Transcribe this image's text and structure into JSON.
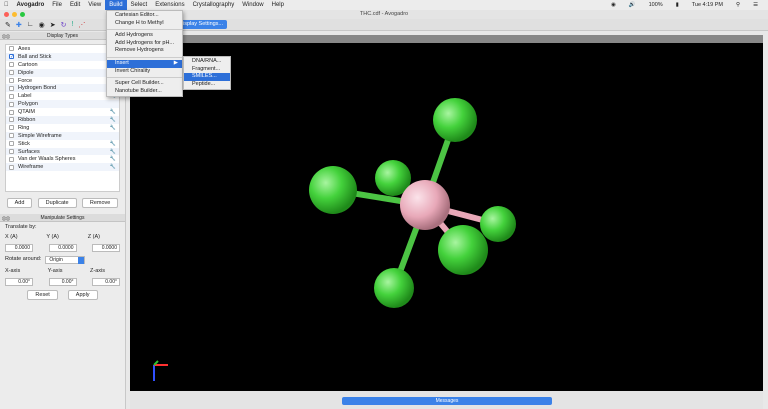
{
  "menubar": {
    "apple": "",
    "items": [
      "Avogadro",
      "File",
      "Edit",
      "View",
      "Build",
      "Select",
      "Extensions",
      "Crystallography",
      "Window",
      "Help"
    ],
    "battery": "100%",
    "clock": "Tue 4:19 PM"
  },
  "window": {
    "title": "THC.cdf - Avogadro"
  },
  "toolbar": {
    "display_settings": "Display Settings..."
  },
  "display_types": {
    "title": "Display Types",
    "items": [
      {
        "label": "Axes",
        "checked": false,
        "config": false
      },
      {
        "label": "Ball and Stick",
        "checked": true,
        "config": true
      },
      {
        "label": "Cartoon",
        "checked": false,
        "config": true
      },
      {
        "label": "Dipole",
        "checked": false,
        "config": false
      },
      {
        "label": "Force",
        "checked": false,
        "config": false
      },
      {
        "label": "Hydrogen Bond",
        "checked": false,
        "config": true
      },
      {
        "label": "Label",
        "checked": false,
        "config": true
      },
      {
        "label": "Polygon",
        "checked": false,
        "config": false
      },
      {
        "label": "QTAIM",
        "checked": false,
        "config": true
      },
      {
        "label": "Ribbon",
        "checked": false,
        "config": true
      },
      {
        "label": "Ring",
        "checked": false,
        "config": true
      },
      {
        "label": "Simple Wireframe",
        "checked": false,
        "config": false
      },
      {
        "label": "Stick",
        "checked": false,
        "config": true
      },
      {
        "label": "Surfaces",
        "checked": false,
        "config": true
      },
      {
        "label": "Van der Waals Spheres",
        "checked": false,
        "config": true
      },
      {
        "label": "Wireframe",
        "checked": false,
        "config": true
      }
    ],
    "add": "Add",
    "duplicate": "Duplicate",
    "remove": "Remove"
  },
  "manipulate": {
    "title": "Manipulate Settings",
    "translate_by": "Translate by:",
    "x_label": "X (A)",
    "y_label": "Y (A)",
    "z_label": "Z (A)",
    "x": "0.0000",
    "y": "0.0000",
    "z": "0.0000",
    "rotate_around": "Rotate around:",
    "origin": "Origin",
    "xaxis_label": "X-axis",
    "yaxis_label": "Y-axis",
    "zaxis_label": "Z-axis",
    "xaxis": "0.00°",
    "yaxis": "0.00°",
    "zaxis": "0.00°",
    "reset": "Reset",
    "apply": "Apply"
  },
  "build_menu": {
    "items": [
      "Cartesian Editor...",
      "Change H to Methyl",
      "Add Hydrogens",
      "Add Hydrogens for pH...",
      "Remove Hydrogens",
      "Insert",
      "Invert Chirality",
      "Super Cell Builder...",
      "Nanotube Builder..."
    ]
  },
  "insert_submenu": {
    "items": [
      "DNA/RNA...",
      "Fragment...",
      "SMILES...",
      "Peptide..."
    ]
  },
  "messages": "Messages",
  "colors": {
    "accent": "#2d6fd8",
    "halogen": "#44d23c",
    "center": "#e8a8b8"
  }
}
